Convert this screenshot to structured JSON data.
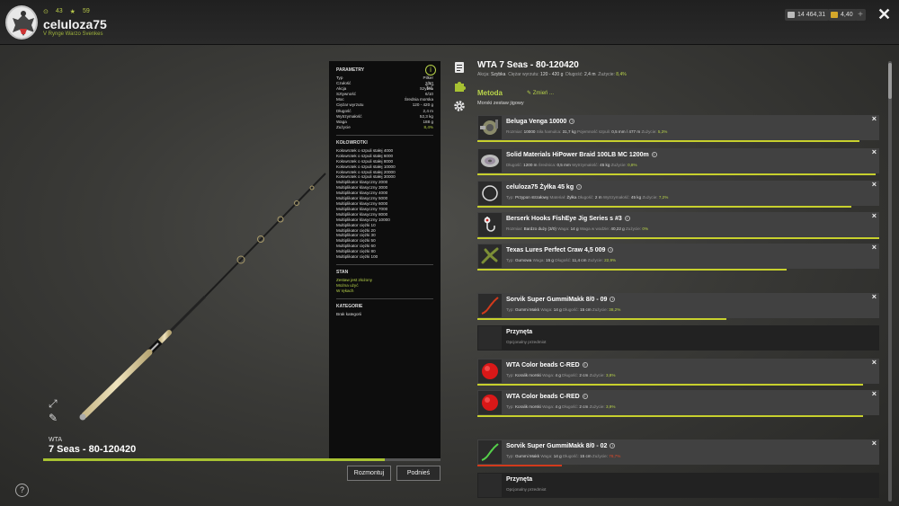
{
  "header": {
    "level_text": "43",
    "rank_text": "59",
    "username": "celuloza75",
    "subtitle": "V Rynge Warzo Svenkes",
    "money": "14 464,31",
    "gold": "4,40",
    "plus": "+",
    "close": "✕"
  },
  "rod": {
    "brand": "WTA",
    "name": "7 Seas - 80-120420",
    "progress": 0.86
  },
  "params": {
    "title": "PARAMETRY",
    "rows": [
      {
        "k": "Typ",
        "v": "Pilker"
      },
      {
        "k": "Czułość",
        "v": "3/10"
      },
      {
        "k": "Akcja",
        "v": "Szybka"
      },
      {
        "k": "Sztywność",
        "v": "6/10"
      },
      {
        "k": "Moc",
        "v": "Średnia morska"
      },
      {
        "k": "Ciężar wyrzutu",
        "v": "120 - 420 g"
      },
      {
        "k": "Długość",
        "v": "2,4 m"
      },
      {
        "k": "Wytrzymałość",
        "v": "52,3 kg"
      },
      {
        "k": "Waga",
        "v": "188 g"
      },
      {
        "k": "Zużycie",
        "v": "8,4%"
      }
    ],
    "compat_title": "KOŁOWROTKI",
    "compat": [
      "Kołowrotek o szpuli stałej 4000",
      "Kołowrotek o szpuli stałej 6000",
      "Kołowrotek o szpuli stałej 8000",
      "Kołowrotek o szpuli stałej 10000",
      "Kołowrotek o szpuli stałej 20000",
      "Kołowrotek o szpuli stałej 30000",
      "Multiplikator klasyczny 2000",
      "Multiplikator klasyczny 3000",
      "Multiplikator klasyczny 4000",
      "Multiplikator klasyczny 5000",
      "Multiplikator klasyczny 6000",
      "Multiplikator klasyczny 7000",
      "Multiplikator klasyczny 8000",
      "Multiplikator klasyczny 10000",
      "Multiplikator ciężki 10",
      "Multiplikator ciężki 20",
      "Multiplikator ciężki 30",
      "Multiplikator ciężki 50",
      "Multiplikator ciężki 60",
      "Multiplikator ciężki 80",
      "Multiplikator ciężki 100"
    ],
    "state_title": "STAN",
    "state": [
      "Zestaw jest złożony",
      "Można użyć",
      "W rękach"
    ],
    "category_title": "KATEGORIE",
    "category": "Brak kategorii"
  },
  "buttons": {
    "disassemble": "Rozmontuj",
    "lift": "Podnieś"
  },
  "help": "?",
  "panel": {
    "title": "WTA 7 Seas - 80-120420",
    "sub_k1": "Akcja:",
    "sub_v1": "Szybka",
    "sub_k2": "Ciężar wyrzutu:",
    "sub_v2": "120 - 420 g",
    "sub_k3": "Długość:",
    "sub_v3": "2,4 m",
    "sub_k4": "Zużycie:",
    "sub_v4": "8,4%",
    "method_label": "Metoda",
    "change_label": "Zmień ...",
    "method_value": "Morski zestaw jigowy"
  },
  "items": [
    {
      "name": "Beluga Venga 10000",
      "meta": [
        [
          "Rozmiar:",
          "10000"
        ],
        [
          "Siła hamulca:",
          "31,7 kg"
        ],
        [
          "Pojemność szpuli:",
          "0,5 mm / 477 m"
        ],
        [
          "Zużycie:",
          "5,3%"
        ]
      ],
      "wear": 0.95,
      "icon": "reel"
    },
    {
      "name": "Solid Materials HiPower Braid 100LB MC 1200m",
      "meta": [
        [
          "Długość:",
          "1200 m"
        ],
        [
          "Średnica:",
          "0,5 mm"
        ],
        [
          "Wytrzymałość:",
          "45 kg"
        ],
        [
          "Zużycie:",
          "0,8%"
        ]
      ],
      "wear": 0.99,
      "icon": "spool"
    },
    {
      "name": "celuloza75 Żyłka 45 kg",
      "meta": [
        [
          "Typ:",
          "Przypon strzałowy"
        ],
        [
          "Materiał:",
          "Żyłka"
        ],
        [
          "Długość:",
          "2 m"
        ],
        [
          "Wytrzymałość:",
          "45 kg"
        ],
        [
          "Zużycie:",
          "7,2%"
        ]
      ],
      "wear": 0.93,
      "icon": "line"
    },
    {
      "name": "Berserk Hooks FishEye Jig Series s #3",
      "meta": [
        [
          "Rozmiar:",
          "Bardzo duży (3/0)"
        ],
        [
          "Waga:",
          "14 g"
        ],
        [
          "Waga w wodzie:",
          "40,22 g"
        ],
        [
          "Zużycie:",
          "0%"
        ]
      ],
      "wear": 1.0,
      "icon": "hook"
    },
    {
      "name": "Texas Lures Perfect Craw 4,5 009",
      "meta": [
        [
          "Typ:",
          "Gumowa"
        ],
        [
          "Waga:",
          "15 g"
        ],
        [
          "Długość:",
          "11,4 cm"
        ],
        [
          "Zużycie:",
          "22,9%"
        ]
      ],
      "wear": 0.77,
      "icon": "craw"
    },
    {
      "name": "Sorvik Super GummiMakk 8/0 - 09",
      "meta": [
        [
          "Typ:",
          "Gummi Makk"
        ],
        [
          "Waga:",
          "14 g"
        ],
        [
          "Długość:",
          "15 cm"
        ],
        [
          "Zużycie:",
          "38,2%"
        ]
      ],
      "wear": 0.62,
      "icon": "worm-red"
    },
    {
      "name": "Przynęta",
      "sub": "Opcjonalny przedmiot",
      "dark": true
    },
    {
      "name": "WTA Color beads C-RED",
      "meta": [
        [
          "Typ:",
          "Koralik morski"
        ],
        [
          "Waga:",
          "4 g"
        ],
        [
          "Długość:",
          "2 cm"
        ],
        [
          "Zużycie:",
          "3,8%"
        ]
      ],
      "wear": 0.96,
      "icon": "bead"
    },
    {
      "name": "WTA Color beads C-RED",
      "meta": [
        [
          "Typ:",
          "Koralik morski"
        ],
        [
          "Waga:",
          "4 g"
        ],
        [
          "Długość:",
          "2 cm"
        ],
        [
          "Zużycie:",
          "3,9%"
        ]
      ],
      "wear": 0.96,
      "icon": "bead"
    },
    {
      "name": "Sorvik Super GummiMakk 8/0 - 02",
      "meta": [
        [
          "Typ:",
          "Gummi Makk"
        ],
        [
          "Waga:",
          "14 g"
        ],
        [
          "Długość:",
          "15 cm"
        ],
        [
          "Zużycie:",
          "78,7%"
        ]
      ],
      "wear": 0.21,
      "icon": "worm-green",
      "red": true
    },
    {
      "name": "Przynęta",
      "sub": "Opcjonalny przedmiot",
      "dark": true
    }
  ]
}
